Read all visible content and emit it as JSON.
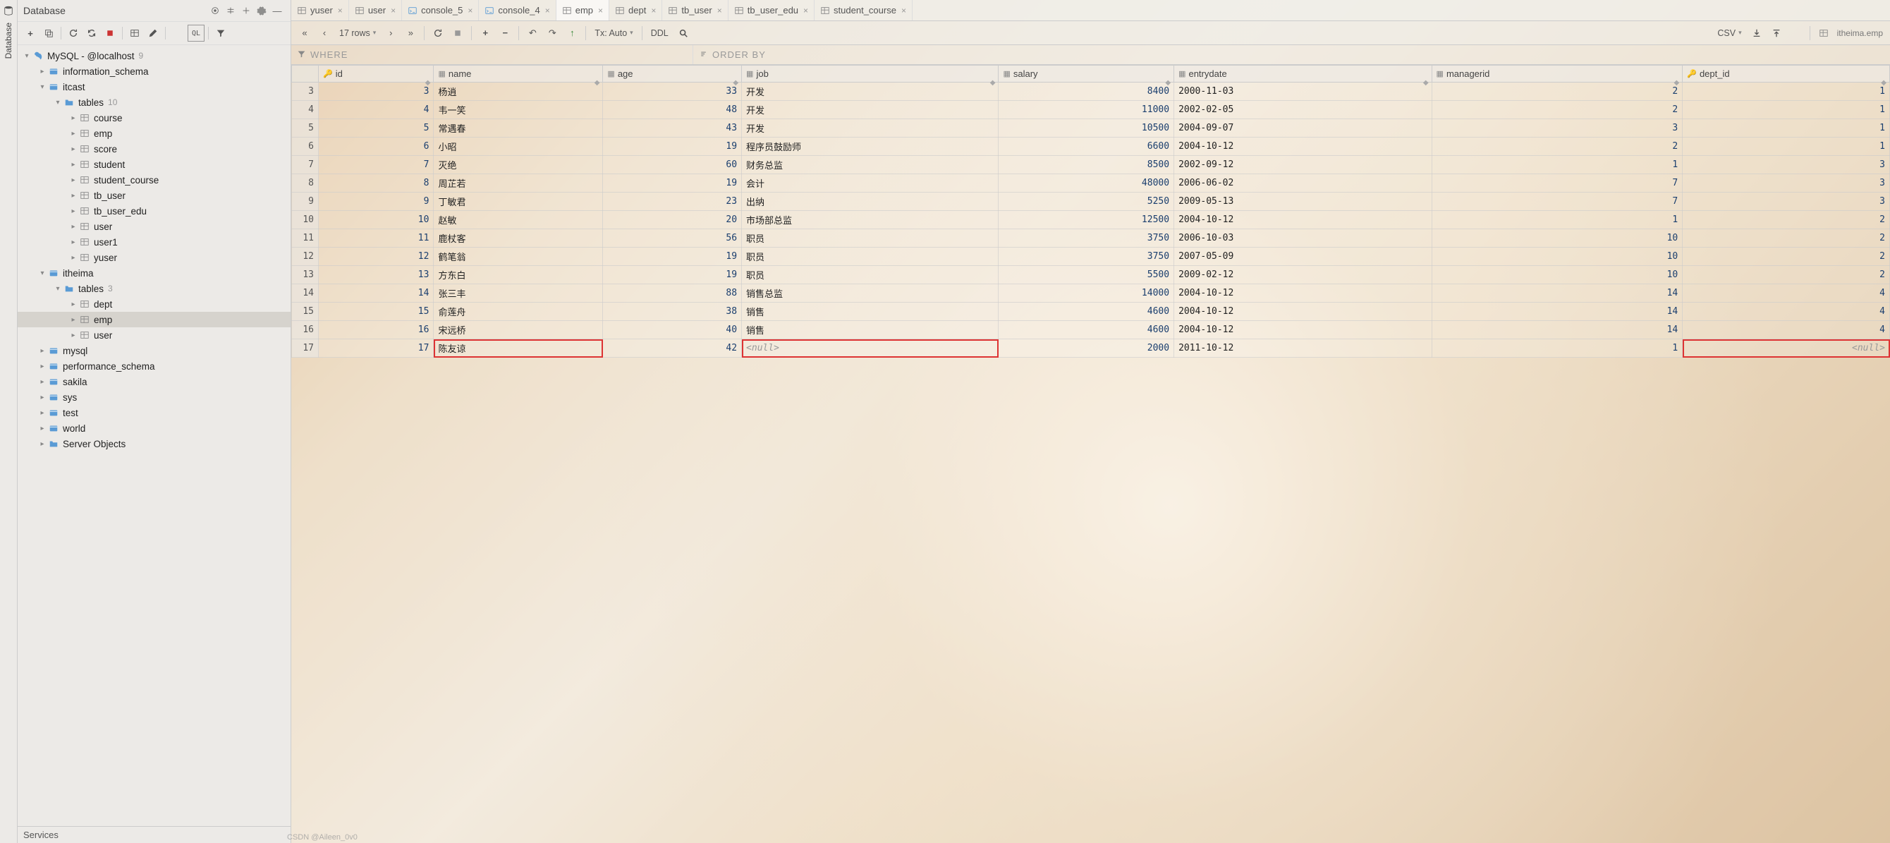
{
  "sidebar": {
    "title": "Database",
    "services_tab": "Services",
    "root": {
      "label": "MySQL - @localhost",
      "badge": "9"
    },
    "tree": [
      {
        "level": 1,
        "type": "schema",
        "label": "information_schema",
        "arrow": ">"
      },
      {
        "level": 1,
        "type": "schema",
        "label": "itcast",
        "arrow": "v"
      },
      {
        "level": 2,
        "type": "folder",
        "label": "tables",
        "badge": "10",
        "arrow": "v"
      },
      {
        "level": 3,
        "type": "table",
        "label": "course",
        "arrow": ">"
      },
      {
        "level": 3,
        "type": "table",
        "label": "emp",
        "arrow": ">"
      },
      {
        "level": 3,
        "type": "table",
        "label": "score",
        "arrow": ">"
      },
      {
        "level": 3,
        "type": "table",
        "label": "student",
        "arrow": ">"
      },
      {
        "level": 3,
        "type": "table",
        "label": "student_course",
        "arrow": ">"
      },
      {
        "level": 3,
        "type": "table",
        "label": "tb_user",
        "arrow": ">"
      },
      {
        "level": 3,
        "type": "table",
        "label": "tb_user_edu",
        "arrow": ">"
      },
      {
        "level": 3,
        "type": "table",
        "label": "user",
        "arrow": ">"
      },
      {
        "level": 3,
        "type": "table",
        "label": "user1",
        "arrow": ">"
      },
      {
        "level": 3,
        "type": "table",
        "label": "yuser",
        "arrow": ">"
      },
      {
        "level": 1,
        "type": "schema",
        "label": "itheima",
        "arrow": "v"
      },
      {
        "level": 2,
        "type": "folder",
        "label": "tables",
        "badge": "3",
        "arrow": "v"
      },
      {
        "level": 3,
        "type": "table",
        "label": "dept",
        "arrow": ">"
      },
      {
        "level": 3,
        "type": "table",
        "label": "emp",
        "arrow": ">",
        "selected": true
      },
      {
        "level": 3,
        "type": "table",
        "label": "user",
        "arrow": ">"
      },
      {
        "level": 1,
        "type": "schema",
        "label": "mysql",
        "arrow": ">"
      },
      {
        "level": 1,
        "type": "schema",
        "label": "performance_schema",
        "arrow": ">"
      },
      {
        "level": 1,
        "type": "schema",
        "label": "sakila",
        "arrow": ">"
      },
      {
        "level": 1,
        "type": "schema",
        "label": "sys",
        "arrow": ">"
      },
      {
        "level": 1,
        "type": "schema",
        "label": "test",
        "arrow": ">"
      },
      {
        "level": 1,
        "type": "schema",
        "label": "world",
        "arrow": ">"
      },
      {
        "level": 1,
        "type": "folder",
        "label": "Server Objects",
        "arrow": ">"
      }
    ]
  },
  "tabs": [
    {
      "label": "yuser",
      "icon": "table"
    },
    {
      "label": "user",
      "icon": "table"
    },
    {
      "label": "console_5",
      "icon": "console"
    },
    {
      "label": "console_4",
      "icon": "console"
    },
    {
      "label": "emp",
      "icon": "table",
      "active": true
    },
    {
      "label": "dept",
      "icon": "table"
    },
    {
      "label": "tb_user",
      "icon": "table"
    },
    {
      "label": "tb_user_edu",
      "icon": "table"
    },
    {
      "label": "student_course",
      "icon": "table"
    }
  ],
  "toolbar": {
    "rows_label": "17 rows",
    "tx_label": "Tx: Auto",
    "ddl_label": "DDL",
    "csv_label": "CSV",
    "context_label": "itheima.emp"
  },
  "filters": {
    "where_label": "WHERE",
    "orderby_label": "ORDER BY"
  },
  "columns": [
    {
      "name": "id",
      "key": true
    },
    {
      "name": "name"
    },
    {
      "name": "age"
    },
    {
      "name": "job"
    },
    {
      "name": "salary"
    },
    {
      "name": "entrydate"
    },
    {
      "name": "managerid"
    },
    {
      "name": "dept_id",
      "key": true
    }
  ],
  "rows": [
    {
      "n": 3,
      "id": 3,
      "name": "杨逍",
      "age": 33,
      "job": "开发",
      "salary": 8400,
      "entrydate": "2000-11-03",
      "managerid": 2,
      "dept_id": 1
    },
    {
      "n": 4,
      "id": 4,
      "name": "韦一笑",
      "age": 48,
      "job": "开发",
      "salary": 11000,
      "entrydate": "2002-02-05",
      "managerid": 2,
      "dept_id": 1
    },
    {
      "n": 5,
      "id": 5,
      "name": "常遇春",
      "age": 43,
      "job": "开发",
      "salary": 10500,
      "entrydate": "2004-09-07",
      "managerid": 3,
      "dept_id": 1
    },
    {
      "n": 6,
      "id": 6,
      "name": "小昭",
      "age": 19,
      "job": "程序员鼓励师",
      "salary": 6600,
      "entrydate": "2004-10-12",
      "managerid": 2,
      "dept_id": 1
    },
    {
      "n": 7,
      "id": 7,
      "name": "灭绝",
      "age": 60,
      "job": "财务总监",
      "salary": 8500,
      "entrydate": "2002-09-12",
      "managerid": 1,
      "dept_id": 3
    },
    {
      "n": 8,
      "id": 8,
      "name": "周芷若",
      "age": 19,
      "job": "会计",
      "salary": 48000,
      "entrydate": "2006-06-02",
      "managerid": 7,
      "dept_id": 3
    },
    {
      "n": 9,
      "id": 9,
      "name": "丁敏君",
      "age": 23,
      "job": "出纳",
      "salary": 5250,
      "entrydate": "2009-05-13",
      "managerid": 7,
      "dept_id": 3
    },
    {
      "n": 10,
      "id": 10,
      "name": "赵敏",
      "age": 20,
      "job": "市场部总监",
      "salary": 12500,
      "entrydate": "2004-10-12",
      "managerid": 1,
      "dept_id": 2
    },
    {
      "n": 11,
      "id": 11,
      "name": "鹿杖客",
      "age": 56,
      "job": "职员",
      "salary": 3750,
      "entrydate": "2006-10-03",
      "managerid": 10,
      "dept_id": 2
    },
    {
      "n": 12,
      "id": 12,
      "name": "鹤笔翁",
      "age": 19,
      "job": "职员",
      "salary": 3750,
      "entrydate": "2007-05-09",
      "managerid": 10,
      "dept_id": 2
    },
    {
      "n": 13,
      "id": 13,
      "name": "方东白",
      "age": 19,
      "job": "职员",
      "salary": 5500,
      "entrydate": "2009-02-12",
      "managerid": 10,
      "dept_id": 2
    },
    {
      "n": 14,
      "id": 14,
      "name": "张三丰",
      "age": 88,
      "job": "销售总监",
      "salary": 14000,
      "entrydate": "2004-10-12",
      "managerid": 14,
      "dept_id": 4
    },
    {
      "n": 15,
      "id": 15,
      "name": "俞莲舟",
      "age": 38,
      "job": "销售",
      "salary": 4600,
      "entrydate": "2004-10-12",
      "managerid": 14,
      "dept_id": 4
    },
    {
      "n": 16,
      "id": 16,
      "name": "宋远桥",
      "age": 40,
      "job": "销售",
      "salary": 4600,
      "entrydate": "2004-10-12",
      "managerid": 14,
      "dept_id": 4
    },
    {
      "n": 17,
      "id": 17,
      "name": "陈友谅",
      "age": 42,
      "job": null,
      "salary": 2000,
      "entrydate": "2011-10-12",
      "managerid": 1,
      "dept_id": null,
      "box_name": true,
      "box_job": true,
      "box_dept": true
    }
  ],
  "watermark": "CSDN @Aileen_0v0"
}
